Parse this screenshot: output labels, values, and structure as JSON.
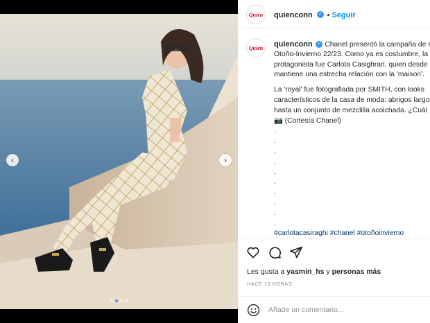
{
  "post": {
    "username": "quienconn",
    "avatar_text": "Quién",
    "follow_label": "Seguir",
    "verified_glyph": "✓"
  },
  "caption": {
    "lines": [
      "Chanel presentó la campaña de su",
      "Otoño-Invierno 22/23. Como ya es costumbre, la",
      "protagonista fue Carlota Casighrari, quien desde",
      "mantiene una estrecha relación con la 'maison'."
    ],
    "para2": [
      "La 'royal' fue fotografiada por SMITH, con looks",
      "característicos de la casa de moda: abrigos largos",
      "hasta un conjunto de mezclilla acolchada. ¿Cuál",
      "(Cortesía Chanel)"
    ],
    "camera_glyph": "📷",
    "dots": [
      ".",
      ".",
      ".",
      ".",
      ".",
      ".",
      ".",
      ".",
      ".",
      "."
    ],
    "hashtags": [
      "#carlotacasiraghi",
      "#chanel",
      "#otoñoinvierno"
    ]
  },
  "likes": {
    "prefix": "Les gusta a",
    "user": "yasmin_hs",
    "middle": "y",
    "others": "personas más"
  },
  "time_label": "HACE 10 HORAS",
  "comment": {
    "placeholder": "Añade un comentario..."
  },
  "carousel": {
    "prev_glyph": "‹",
    "next_glyph": "›",
    "dot_count": 4,
    "active_index": 1
  },
  "icons": {
    "like": "heart-icon",
    "comment": "comment-icon",
    "share": "share-icon",
    "emoji": "emoji-icon",
    "verified": "verified-icon"
  },
  "colors": {
    "accent": "#0095f6",
    "verified": "#3897f0",
    "hashtag": "#00376b",
    "brand_red": "#c8102e"
  }
}
